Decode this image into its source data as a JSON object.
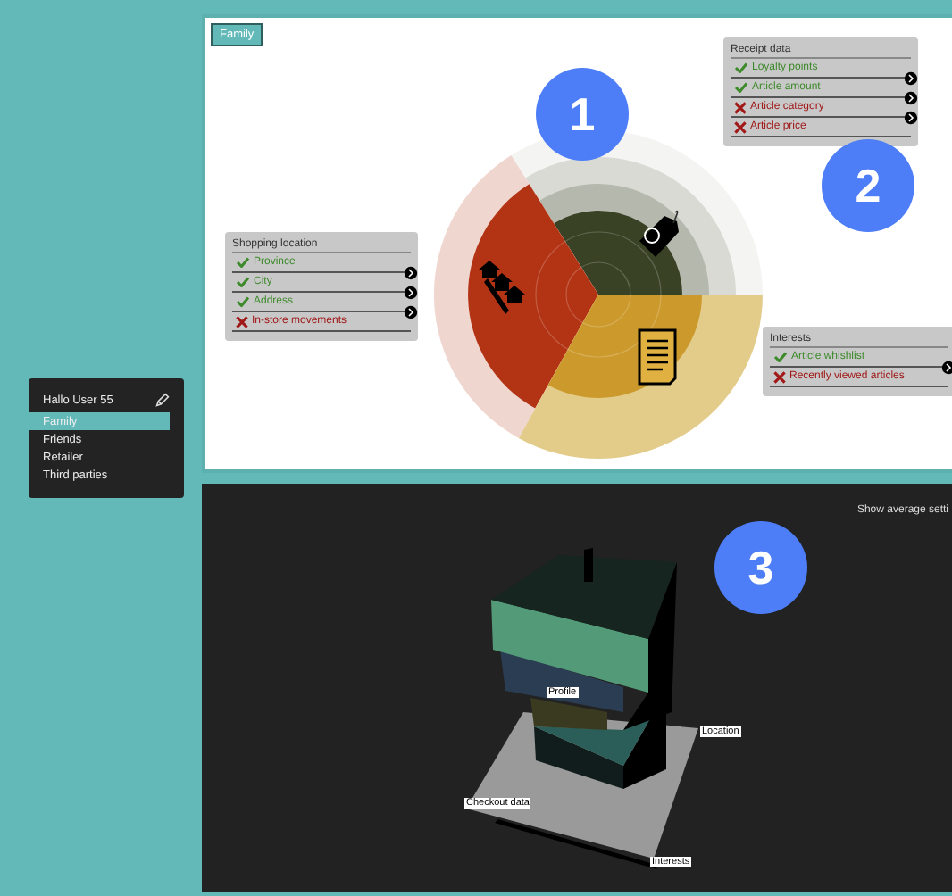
{
  "sidebar": {
    "user": "Hallo User 55",
    "items": [
      {
        "label": "Family",
        "selected": true
      },
      {
        "label": "Friends",
        "selected": false
      },
      {
        "label": "Retailer",
        "selected": false
      },
      {
        "label": "Third parties",
        "selected": false
      }
    ]
  },
  "top_panel": {
    "tag": "Family",
    "markers": [
      "1",
      "2"
    ],
    "boxes": [
      {
        "title": "Receipt data",
        "rows": [
          {
            "label": "Loyalty points",
            "allowed": true
          },
          {
            "label": "Article amount",
            "allowed": true
          },
          {
            "label": "Article category",
            "allowed": false
          },
          {
            "label": "Article price",
            "allowed": false
          }
        ]
      },
      {
        "title": "Shopping location",
        "rows": [
          {
            "label": "Province",
            "allowed": true
          },
          {
            "label": "City",
            "allowed": true
          },
          {
            "label": "Address",
            "allowed": true
          },
          {
            "label": "In-store movements",
            "allowed": false
          }
        ]
      },
      {
        "title": "Interests",
        "rows": [
          {
            "label": "Article whishlist",
            "allowed": true
          },
          {
            "label": "Recently viewed articles",
            "allowed": false
          }
        ]
      }
    ]
  },
  "bottom_panel": {
    "link": "Show average setti",
    "marker": "3",
    "labels": [
      "Profile",
      "Location",
      "Checkout data",
      "Interests"
    ]
  }
}
